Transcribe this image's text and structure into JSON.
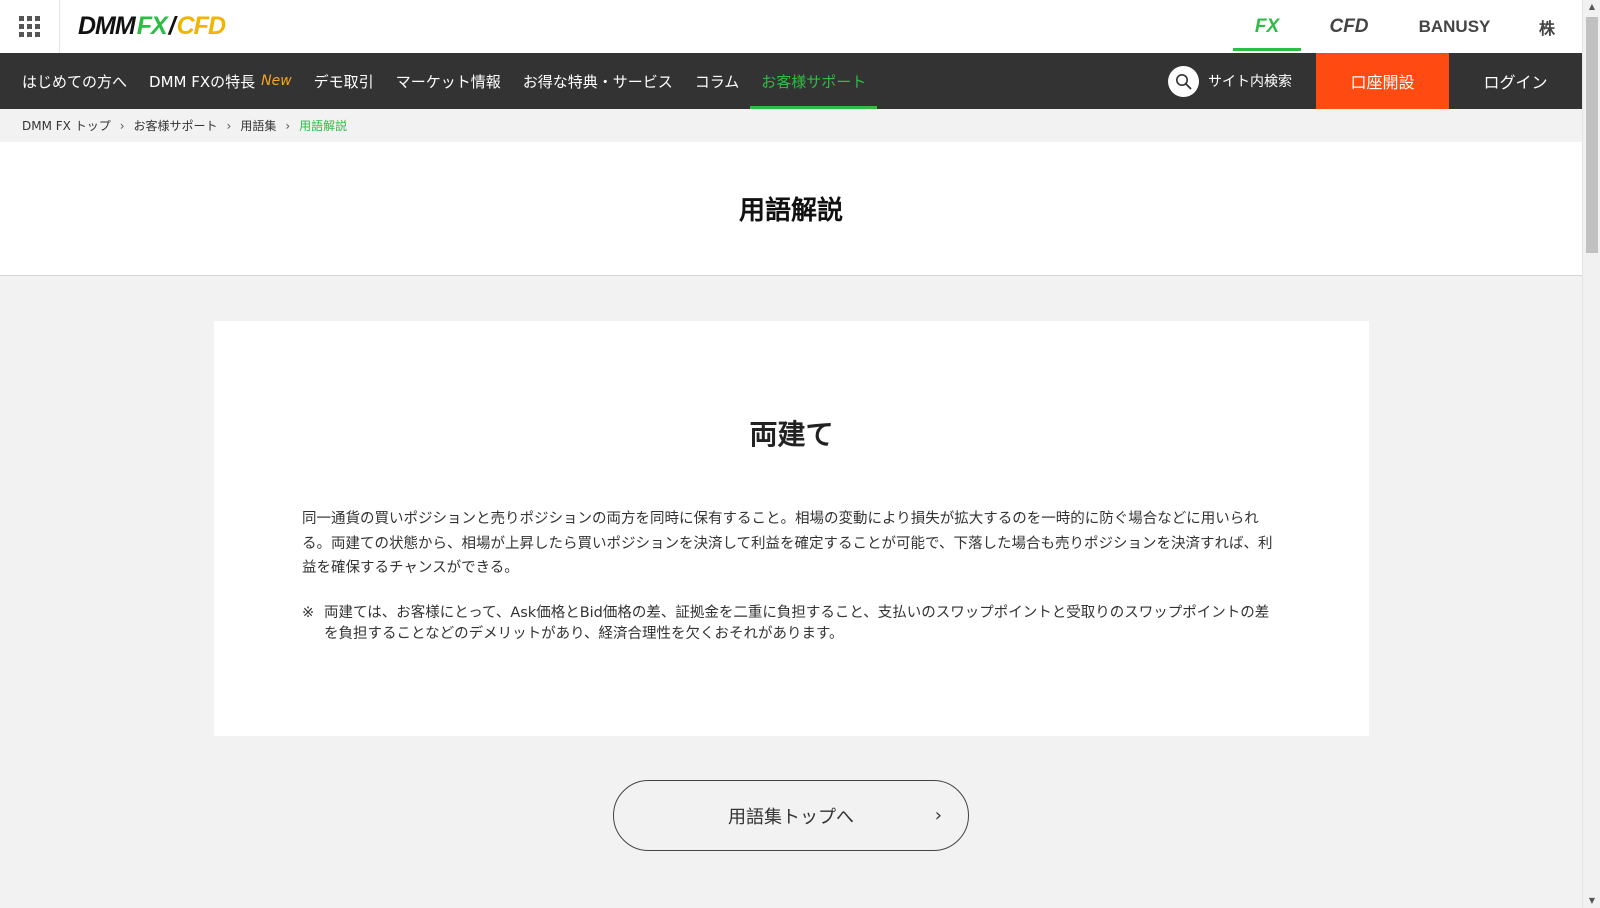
{
  "header": {
    "logo": {
      "part1": "DMM",
      "part2": "FX",
      "part3": "/",
      "part4": "CFD"
    },
    "brand_tabs": [
      "FX",
      "CFD",
      "BANUSY",
      "株"
    ]
  },
  "nav": {
    "items": [
      "はじめての方へ",
      "DMM FXの特長",
      "デモ取引",
      "マーケット情報",
      "お得な特典・サービス",
      "コラム",
      "お客様サポート"
    ],
    "new_badge": "New",
    "search_label": "サイト内検索",
    "open_account": "口座開設",
    "login": "ログイン"
  },
  "breadcrumb": [
    "DMM FX トップ",
    "お客様サポート",
    "用語集",
    "用語解説"
  ],
  "page_title": "用語解説",
  "term": {
    "title": "両建て",
    "definition": "同一通貨の買いポジションと売りポジションの両方を同時に保有すること。相場の変動により損失が拡大するのを一時的に防ぐ場合などに用いられる。両建ての状態から、相場が上昇したら買いポジションを決済して利益を確定することが可能で、下落した場合も売りポジションを決済すれば、利益を確保するチャンスができる。",
    "note_mark": "※",
    "note": "両建ては、お客様にとって、Ask価格とBid価格の差、証拠金を二重に負担すること、支払いのスワップポイントと受取りのスワップポイントの差を負担することなどのデメリットがあり、経済合理性を欠くおそれがあります。"
  },
  "back_button": {
    "label": "用語集トップへ",
    "chevron": "›"
  },
  "colors": {
    "accent_green": "#2dbd45",
    "open_account_orange": "#ff4b12",
    "nav_bg": "#333333",
    "cfd_yellow": "#f2b400"
  }
}
